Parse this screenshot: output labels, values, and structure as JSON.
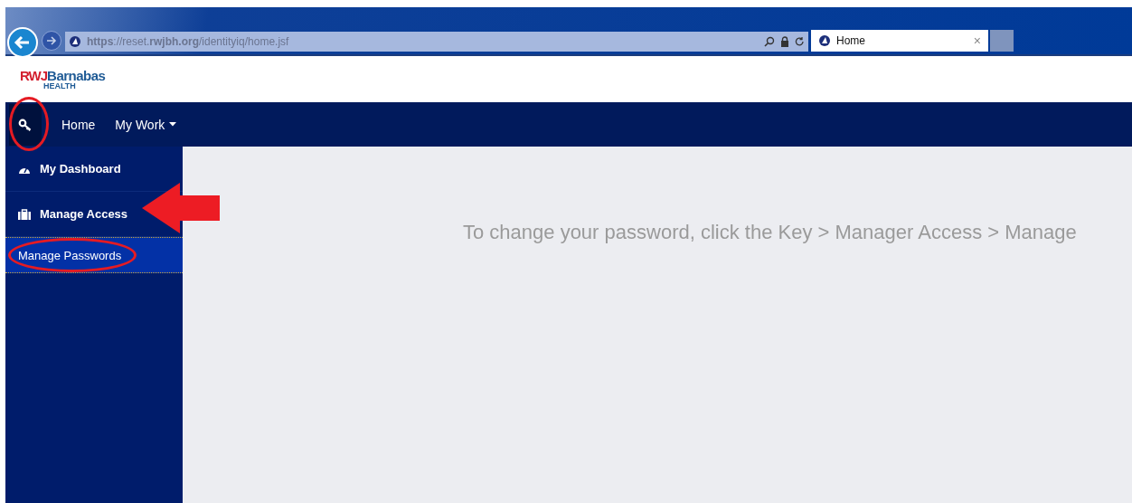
{
  "browser": {
    "url": "**https**://reset.**rwjbh.org**/identityiq/home.jsf",
    "tab": {
      "title": "Home",
      "close": "×",
      "selected": true
    }
  },
  "logo": {
    "brand_red": "RWJ",
    "brand_blue": "Barnabas",
    "sub": "HEALTH"
  },
  "nav": {
    "items": [
      "Home",
      "My Work"
    ]
  },
  "sidebar": {
    "items": [
      {
        "label": "My Dashboard"
      },
      {
        "label": "Manage Access",
        "children": [
          {
            "label": "Manage Passwords",
            "selected": true
          }
        ]
      }
    ]
  },
  "content": {
    "message": "To change your password, click the Key > Manager Access > Manage"
  }
}
